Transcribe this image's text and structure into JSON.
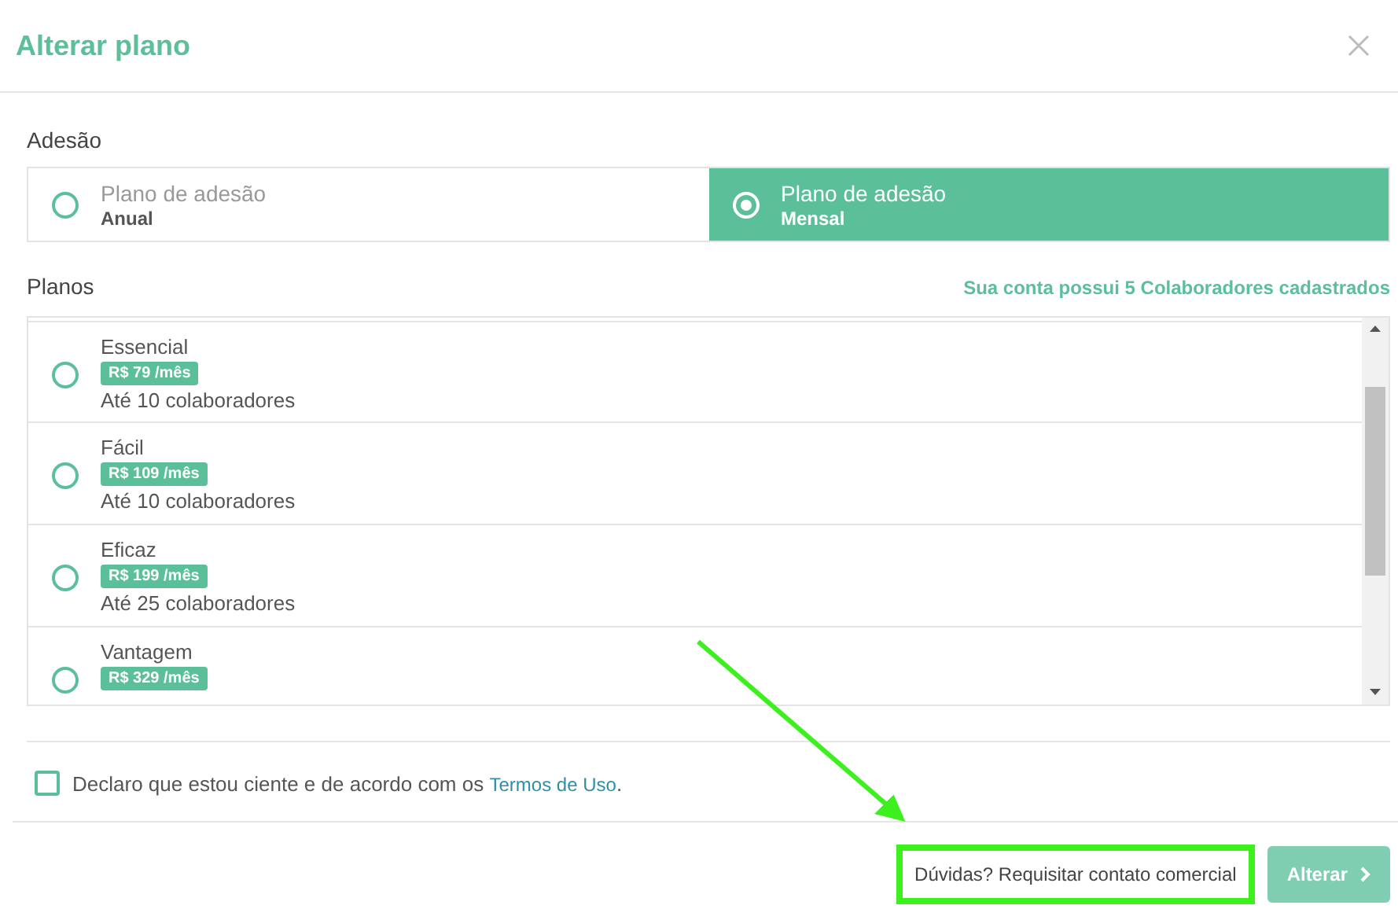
{
  "window": {
    "title": "Alterar plano"
  },
  "adhesion": {
    "heading": "Adesão",
    "options": [
      {
        "label": "Plano de adesão",
        "period": "Anual",
        "selected": false
      },
      {
        "label": "Plano de adesão",
        "period": "Mensal",
        "selected": true
      }
    ]
  },
  "plans": {
    "heading": "Planos",
    "note": "Sua conta possui 5 Colaboradores cadastrados",
    "items": [
      {
        "name": "Essencial",
        "price": "R$ 79 /mês",
        "limit": "Até 10 colaboradores",
        "selected": false
      },
      {
        "name": "Fácil",
        "price": "R$ 109 /mês",
        "limit": "Até 10 colaboradores",
        "selected": false
      },
      {
        "name": "Eficaz",
        "price": "R$ 199 /mês",
        "limit": "Até 25 colaboradores",
        "selected": false
      },
      {
        "name": "Vantagem",
        "price": "R$ 329 /mês",
        "selected": false
      }
    ]
  },
  "terms": {
    "text": "Declaro que estou ciente e de acordo com os",
    "link": "Termos de Uso",
    "suffix": ".",
    "checked": false
  },
  "footer": {
    "contact_button": "Dúvidas? Requisitar contato comercial",
    "submit_button": "Alterar",
    "submit_disabled": true
  }
}
